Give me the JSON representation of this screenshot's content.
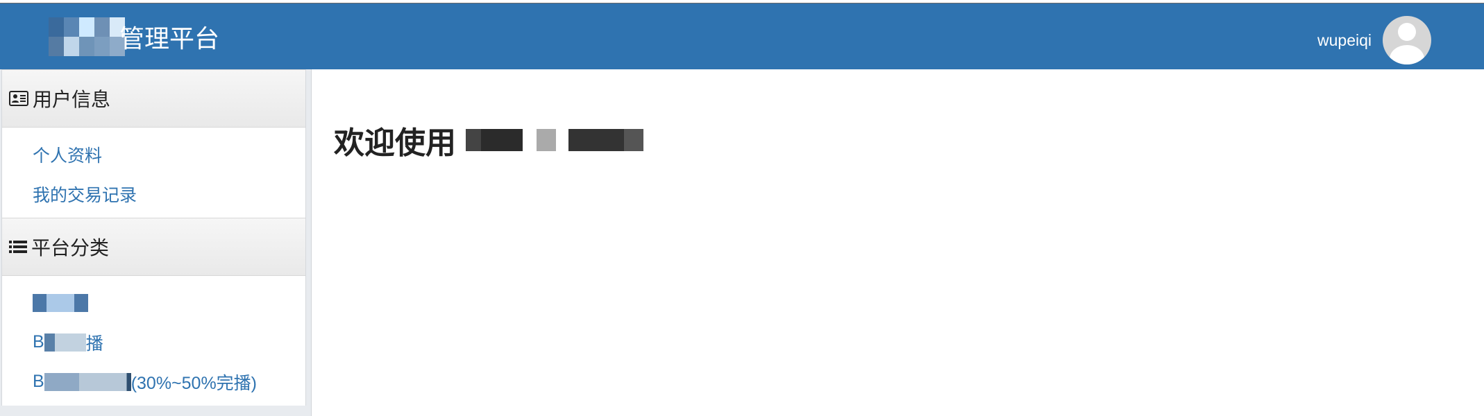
{
  "header": {
    "brand_suffix": "管理平台",
    "username": "wupeiqi"
  },
  "sidebar": {
    "sections": [
      {
        "title": "用户信息",
        "icon": "id-card-icon",
        "items": [
          {
            "label": "个人资料"
          },
          {
            "label": "我的交易记录"
          }
        ]
      },
      {
        "title": "平台分类",
        "icon": "list-icon",
        "items": [
          {
            "label": ""
          },
          {
            "label_prefix": "B",
            "label_suffix": "播"
          },
          {
            "label_prefix": "B",
            "label_suffix": "(30%~50%完播)"
          }
        ]
      }
    ]
  },
  "main": {
    "welcome_prefix": "欢迎使用"
  },
  "colors": {
    "header_bg": "#2f73b0",
    "link": "#2f73b0",
    "sidebar_bg": "#e8ebef"
  }
}
